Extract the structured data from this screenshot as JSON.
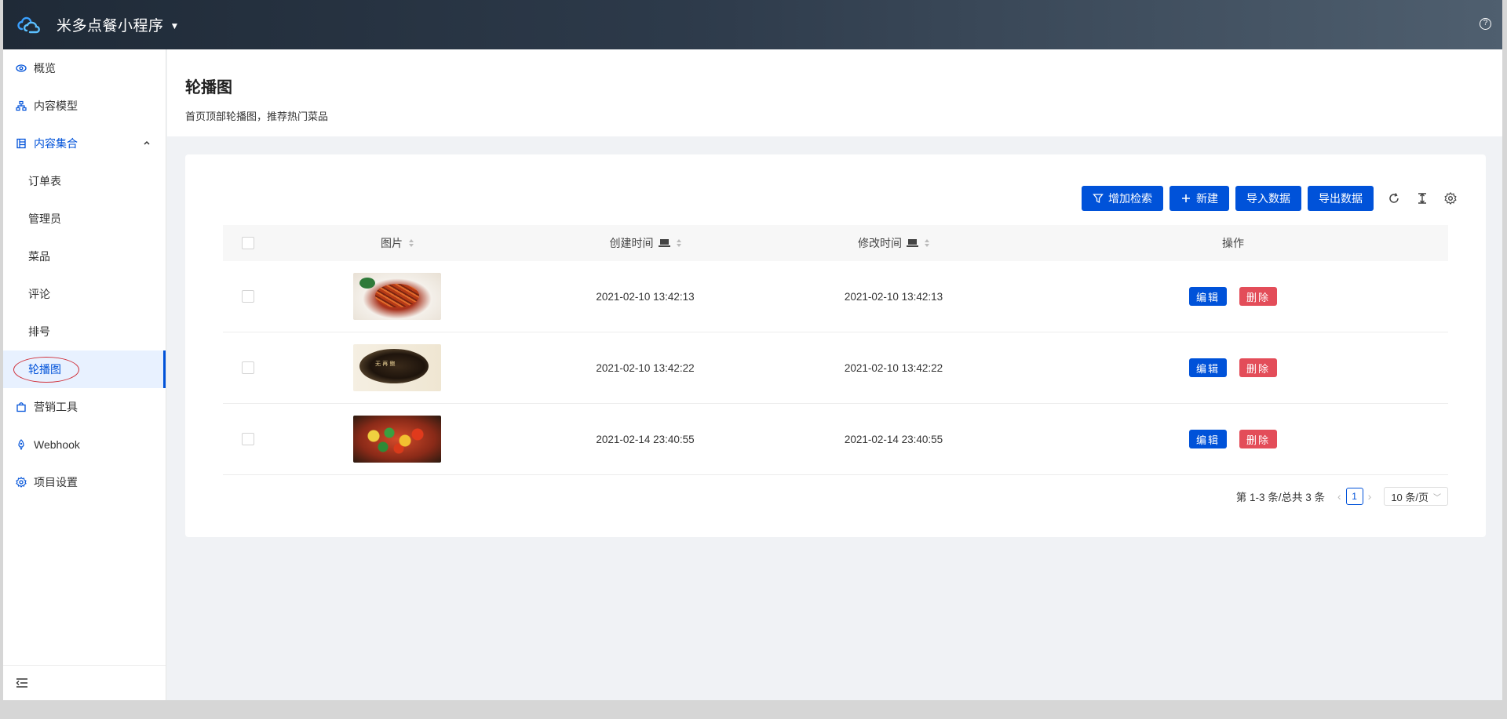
{
  "topbar": {
    "app_title": "米多点餐小程序",
    "logo_icon": "cloud-logo-icon",
    "help_icon": "help-icon",
    "colors": {
      "start": "#1f2a37",
      "end": "#4f5f6f"
    }
  },
  "sidebar": {
    "items": [
      {
        "label": "概览",
        "icon": "eye-icon"
      },
      {
        "label": "内容模型",
        "icon": "model-icon"
      },
      {
        "label": "内容集合",
        "icon": "collection-icon",
        "expanded": true
      },
      {
        "label": "订单表"
      },
      {
        "label": "管理员"
      },
      {
        "label": "菜品"
      },
      {
        "label": "评论"
      },
      {
        "label": "排号"
      },
      {
        "label": "轮播图",
        "active": true
      },
      {
        "label": "营销工具",
        "icon": "bag-icon"
      },
      {
        "label": "Webhook",
        "icon": "rocket-icon"
      },
      {
        "label": "项目设置",
        "icon": "gear-icon"
      }
    ],
    "footer_icon": "collapse-menu-icon"
  },
  "header": {
    "title": "轮播图",
    "description": "首页顶部轮播图，推荐热门菜品"
  },
  "toolbar": {
    "add_filter": "增加检索",
    "create": "新建",
    "import": "导入数据",
    "export": "导出数据"
  },
  "table": {
    "columns": [
      "图片",
      "创建时间",
      "修改时间",
      "操作"
    ],
    "rows": [
      {
        "image": "stir-fried-shredded-dish",
        "created": "2021-02-10 13:42:13",
        "modified": "2021-02-10 13:42:13"
      },
      {
        "image": "braised-abalone-dish",
        "created": "2021-02-10 13:42:22",
        "modified": "2021-02-10 13:42:22"
      },
      {
        "image": "diced-vegetable-dish",
        "created": "2021-02-14 23:40:55",
        "modified": "2021-02-14 23:40:55"
      }
    ],
    "edit_label": "编辑",
    "delete_label": "删除"
  },
  "pagination": {
    "summary": "第 1-3 条/总共 3 条",
    "current_page": "1",
    "page_size": "10 条/页"
  },
  "colors": {
    "primary": "#0052d9",
    "danger": "#e34d59",
    "annotation": "#d0303a"
  }
}
